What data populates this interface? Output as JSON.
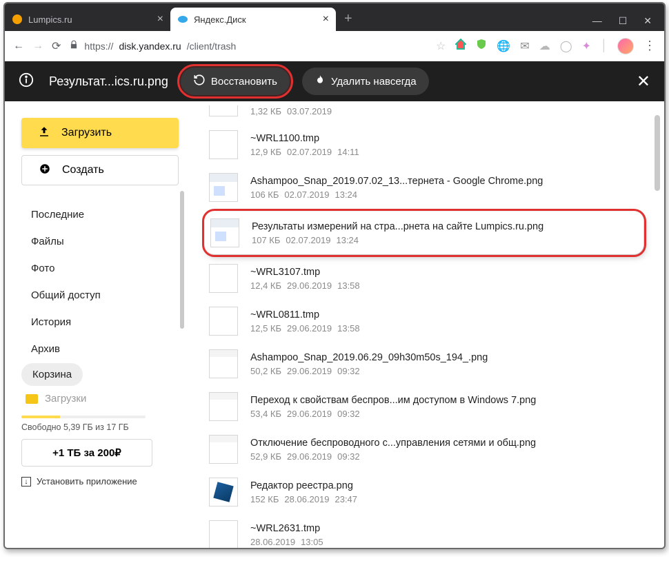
{
  "browser": {
    "tabs": [
      {
        "title": "Lumpics.ru"
      },
      {
        "title": "Яндекс.Диск"
      }
    ],
    "url_gray": "https://",
    "url_dark": "disk.yandex.ru",
    "url_rest": "/client/trash"
  },
  "actionbar": {
    "filename": "Результат...ics.ru.png",
    "restore": "Восстановить",
    "delete_forever": "Удалить навсегда"
  },
  "sidebar": {
    "upload": "Загрузить",
    "create": "Создать",
    "items": [
      "Последние",
      "Файлы",
      "Фото",
      "Общий доступ",
      "История",
      "Архив",
      "Корзина"
    ],
    "folder": "Загрузки",
    "quota_text": "Свободно 5,39 ГБ из 17 ГБ",
    "upgrade": "+1 ТБ за 200₽",
    "install": "Установить приложение"
  },
  "files": [
    {
      "name": "",
      "size": "1,32 КБ",
      "date": "03.07.2019",
      "time": "",
      "thumb": "blank",
      "cut": true
    },
    {
      "name": "~WRL1100.tmp",
      "size": "12,9 КБ",
      "date": "02.07.2019",
      "time": "14:11",
      "thumb": "blank"
    },
    {
      "name": "Ashampoo_Snap_2019.07.02_13...тернета - Google Chrome.png",
      "size": "106 КБ",
      "date": "02.07.2019",
      "time": "13:24",
      "thumb": "shot"
    },
    {
      "name": "Результаты измерений на стра...рнета на сайте Lumpics.ru.png",
      "size": "107 КБ",
      "date": "02.07.2019",
      "time": "13:24",
      "thumb": "shot",
      "highlight": true
    },
    {
      "name": "~WRL3107.tmp",
      "size": "12,4 КБ",
      "date": "29.06.2019",
      "time": "13:58",
      "thumb": "blank"
    },
    {
      "name": "~WRL0811.tmp",
      "size": "12,5 КБ",
      "date": "29.06.2019",
      "time": "13:58",
      "thumb": "blank"
    },
    {
      "name": "Ashampoo_Snap_2019.06.29_09h30m50s_194_.png",
      "size": "50,2 КБ",
      "date": "29.06.2019",
      "time": "09:32",
      "thumb": "img"
    },
    {
      "name": "Переход к свойствам беспров...им доступом в Windows 7.png",
      "size": "53,4 КБ",
      "date": "29.06.2019",
      "time": "09:32",
      "thumb": "img"
    },
    {
      "name": "Отключение беспроводного с...управления сетями и общ.png",
      "size": "52,9 КБ",
      "date": "29.06.2019",
      "time": "09:32",
      "thumb": "img"
    },
    {
      "name": "Редактор реестра.png",
      "size": "152 КБ",
      "date": "28.06.2019",
      "time": "23:47",
      "thumb": "reg"
    },
    {
      "name": "~WRL2631.tmp",
      "size": "",
      "date": "28.06.2019",
      "time": "13:05",
      "thumb": "blank"
    }
  ]
}
